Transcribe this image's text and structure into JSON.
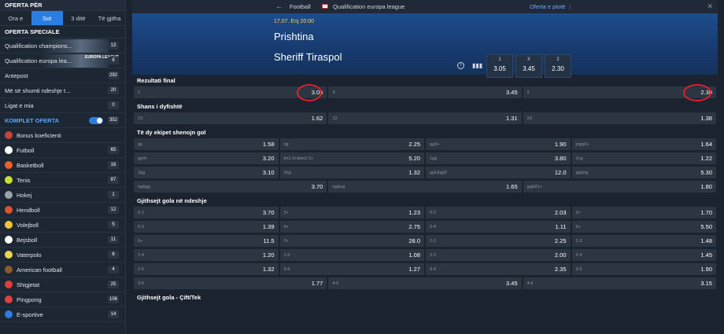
{
  "sidebar": {
    "header": "OFERTA PËR",
    "tabs": [
      "Ora e",
      "Sot",
      "3 ditë",
      "Të gjitha"
    ],
    "active_tab": "Sot",
    "special_title": "OFERTA SPECIALE",
    "special": [
      {
        "label": "Qualification champions...",
        "count": "13"
      },
      {
        "label": "Qualification europa lea...",
        "count": "8",
        "logo": "EUROPA LEAGUE"
      },
      {
        "label": "Antepost",
        "count": "292"
      },
      {
        "label": "Më së shumti ndeshje t...",
        "count": "20"
      },
      {
        "label": "Ligat e mia",
        "count": "0"
      }
    ],
    "komplet_label": "KOMPLET OFERTA",
    "komplet_count": "352",
    "sports": [
      {
        "label": "Bonus koeficienti",
        "count": "",
        "color": "#c0463b"
      },
      {
        "label": "Futboll",
        "count": "65",
        "color": "#ffffff"
      },
      {
        "label": "Basketboll",
        "count": "16",
        "color": "#e8612c"
      },
      {
        "label": "Tenis",
        "count": "87",
        "color": "#c6df2d"
      },
      {
        "label": "Hokej",
        "count": "1",
        "color": "#9aa3ad"
      },
      {
        "label": "Hendboll",
        "count": "12",
        "color": "#d9532c"
      },
      {
        "label": "Volejboll",
        "count": "5",
        "color": "#f2c534"
      },
      {
        "label": "Bejsboll",
        "count": "11",
        "color": "#ffffff"
      },
      {
        "label": "Vaterpolo",
        "count": "6",
        "color": "#e6d44a"
      },
      {
        "label": "American football",
        "count": "4",
        "color": "#8a5a2b"
      },
      {
        "label": "Shigjetat",
        "count": "25",
        "color": "#e33b3b"
      },
      {
        "label": "Pingpong",
        "count": "106",
        "color": "#e04040"
      },
      {
        "label": "E-sportive",
        "count": "14",
        "color": "#2a7de1"
      }
    ]
  },
  "topbar": {
    "back": "←",
    "sport": "Football",
    "league": "Qualification europa league",
    "oferta": "Oferta e plotë ⋮",
    "close": "✕"
  },
  "match": {
    "datetime": "17.07. Enj 20:00",
    "team1": "Prishtina",
    "team2": "Sheriff Tiraspol",
    "info": "i",
    "stats": "▮▮▮",
    "odds": [
      {
        "k": "1",
        "v": "3.05"
      },
      {
        "k": "X",
        "v": "3.45"
      },
      {
        "k": "2",
        "v": "2.30"
      }
    ]
  },
  "markets": [
    {
      "title": "Rezultati final",
      "rows": [
        [
          [
            "1",
            "3.05"
          ],
          [
            "X",
            "3.45"
          ],
          [
            "2",
            "2.30"
          ]
        ]
      ]
    },
    {
      "title": "Shans i dyfishtë",
      "rows": [
        [
          [
            "1X",
            "1.62"
          ],
          [
            "12",
            "1.31"
          ],
          [
            "X2",
            "1.38"
          ]
        ]
      ]
    },
    {
      "title": "Të dy ekipet shenojn gol",
      "rows": [
        [
          [
            "gg",
            "1.58"
          ],
          [
            "ng",
            "2.25"
          ],
          [
            "gg3+",
            "1.90"
          ],
          [
            "jngg3+",
            "1.64"
          ]
        ],
        [
          [
            "gg4+",
            "3.20"
          ],
          [
            "tm1 2+&tm2 2+",
            "5.20"
          ],
          [
            "1gg",
            "3.80"
          ],
          [
            "1ng",
            "1.22"
          ]
        ],
        [
          [
            "2gg",
            "3.10"
          ],
          [
            "2ng",
            "1.32"
          ],
          [
            "gg1&gg2",
            "12.0"
          ],
          [
            "gg&ng",
            "5.30"
          ]
        ],
        [
          [
            "ng&gg",
            "3.70"
          ],
          [
            "ng&ng",
            "1.65"
          ],
          [
            "gg&II1+",
            "1.80"
          ]
        ]
      ]
    },
    {
      "title": "Gjithsejt gola në ndeshje",
      "rows": [
        [
          [
            "0-1",
            "3.70"
          ],
          [
            "2+",
            "1.23"
          ],
          [
            "0-2",
            "2.03"
          ],
          [
            "3+",
            "1.70"
          ]
        ],
        [
          [
            "0-3",
            "1.39"
          ],
          [
            "4+",
            "2.75"
          ],
          [
            "0-4",
            "1.11"
          ],
          [
            "5+",
            "5.50"
          ]
        ],
        [
          [
            "6+",
            "11.5"
          ],
          [
            "7+",
            "28.0"
          ],
          [
            "1-2",
            "2.25"
          ],
          [
            "1-3",
            "1.48"
          ]
        ],
        [
          [
            "1-4",
            "1.20"
          ],
          [
            "1-5",
            "1.08"
          ],
          [
            "2-3",
            "2.00"
          ],
          [
            "2-4",
            "1.45"
          ]
        ],
        [
          [
            "2-5",
            "1.32"
          ],
          [
            "2-6",
            "1.27"
          ],
          [
            "3-4",
            "2.35"
          ],
          [
            "3-5",
            "1.90"
          ]
        ],
        [
          [
            "3-6",
            "1.77"
          ],
          [
            "4-5",
            "3.45"
          ],
          [
            "4-6",
            "3.15"
          ]
        ]
      ]
    },
    {
      "title": "Gjithsejt gola - Çift/Tek",
      "rows": []
    }
  ]
}
